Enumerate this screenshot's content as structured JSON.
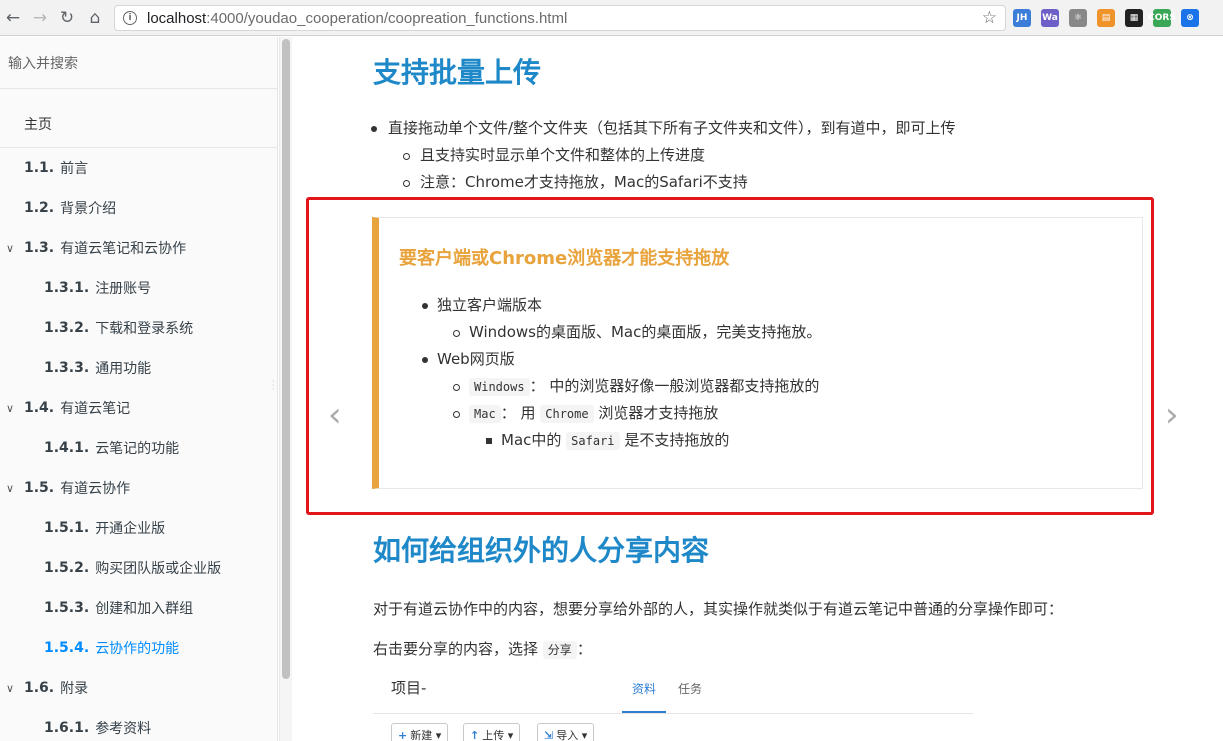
{
  "browser": {
    "url_host": "localhost",
    "url_path": ":4000/youdao_cooperation/coopreation_functions.html",
    "extensions": [
      {
        "name": "jh-extension-icon",
        "label": "JH",
        "color": "#3b7dd8"
      },
      {
        "name": "wappalyzer-icon",
        "label": "Wa",
        "color": "#6c5fc7"
      },
      {
        "name": "react-devtools-icon",
        "label": "⚛",
        "color": "#888888"
      },
      {
        "name": "feed-extension-icon",
        "label": "▤",
        "color": "#f0932b"
      },
      {
        "name": "qr-code-icon",
        "label": "▦",
        "color": "#222222"
      },
      {
        "name": "cors-extension-icon",
        "label": "CORS",
        "color": "#3aa757"
      },
      {
        "name": "translate-extension-icon",
        "label": "⊗",
        "color": "#1a73e8"
      }
    ]
  },
  "sidebar": {
    "search_placeholder": "输入并搜索",
    "home": "主页",
    "items": [
      {
        "num": "1.1.",
        "label": "前言",
        "level": 1,
        "caret": false,
        "active": false
      },
      {
        "num": "1.2.",
        "label": "背景介绍",
        "level": 1,
        "caret": false,
        "active": false
      },
      {
        "num": "1.3.",
        "label": "有道云笔记和云协作",
        "level": 1,
        "caret": true,
        "active": false
      },
      {
        "num": "1.3.1.",
        "label": "注册账号",
        "level": 2,
        "caret": false,
        "active": false
      },
      {
        "num": "1.3.2.",
        "label": "下载和登录系统",
        "level": 2,
        "caret": false,
        "active": false
      },
      {
        "num": "1.3.3.",
        "label": "通用功能",
        "level": 2,
        "caret": false,
        "active": false
      },
      {
        "num": "1.4.",
        "label": "有道云笔记",
        "level": 1,
        "caret": true,
        "active": false
      },
      {
        "num": "1.4.1.",
        "label": "云笔记的功能",
        "level": 2,
        "caret": false,
        "active": false
      },
      {
        "num": "1.5.",
        "label": "有道云协作",
        "level": 1,
        "caret": true,
        "active": false
      },
      {
        "num": "1.5.1.",
        "label": "开通企业版",
        "level": 2,
        "caret": false,
        "active": false
      },
      {
        "num": "1.5.2.",
        "label": "购买团队版或企业版",
        "level": 2,
        "caret": false,
        "active": false
      },
      {
        "num": "1.5.3.",
        "label": "创建和加入群组",
        "level": 2,
        "caret": false,
        "active": false
      },
      {
        "num": "1.5.4.",
        "label": "云协作的功能",
        "level": 2,
        "caret": false,
        "active": true
      },
      {
        "num": "1.6.",
        "label": "附录",
        "level": 1,
        "caret": true,
        "active": false
      },
      {
        "num": "1.6.1.",
        "label": "参考资料",
        "level": 2,
        "caret": false,
        "active": false
      }
    ]
  },
  "content": {
    "heading1": "支持批量上传",
    "bullets1": [
      {
        "text": "直接拖动单个文件/整个文件夹（包括其下所有子文件夹和文件），到有道中，即可上传",
        "sub": false
      },
      {
        "text": "且支持实时显示单个文件和整体的上传进度",
        "sub": true
      },
      {
        "text": "注意：Chrome才支持拖放，Mac的Safari不支持",
        "sub": true
      }
    ],
    "callout": {
      "title": "要客户端或Chrome浏览器才能支持拖放",
      "l1": "独立客户端版本",
      "l1_sub": "Windows的桌面版、Mac的桌面版，完美支持拖放。",
      "l2": "Web网页版",
      "l2_a_code": "Windows",
      "l2_a_text": "： 中的浏览器好像一般浏览器都支持拖放的",
      "l2_b_code": "Mac",
      "l2_b_mid": "： 用",
      "l2_b_code2": "Chrome",
      "l2_b_text": "浏览器才支持拖放",
      "l2_c_pre": "Mac中的",
      "l2_c_code": "Safari",
      "l2_c_text": "是不支持拖放的"
    },
    "heading2": "如何给组织外的人分享内容",
    "para1": "对于有道云协作中的内容，想要分享给外部的人，其实操作就类似于有道云笔记中普通的分享操作即可：",
    "para2_pre": "右击要分享的内容，选择",
    "para2_code": "分享",
    "para2_post": "：",
    "snippet": {
      "title": "项目-",
      "tab_active": "资料",
      "tab_other": "任务",
      "btn_new": "新建",
      "btn_upload": "上传",
      "btn_import": "导入"
    }
  }
}
